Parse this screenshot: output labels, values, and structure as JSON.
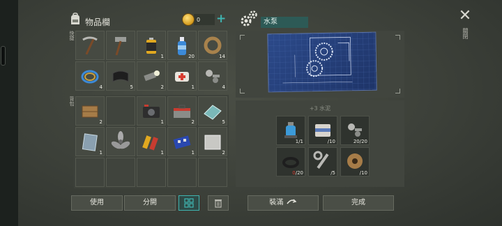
{
  "inventory": {
    "title": "物品欄",
    "coins": "0",
    "plus": "+",
    "hotbar_label": "快捷",
    "backpack_label": "背包",
    "hotbar": [
      {
        "name": "pickaxe",
        "icon": "pickaxe-icon",
        "qty": ""
      },
      {
        "name": "hammer",
        "icon": "hammer-icon",
        "qty": ""
      },
      {
        "name": "battery",
        "icon": "battery-icon",
        "qty": "1"
      },
      {
        "name": "water-bottle",
        "icon": "water-bottle-icon",
        "qty": "20"
      },
      {
        "name": "rope",
        "icon": "rope-icon",
        "qty": "14"
      },
      {
        "name": "wire",
        "icon": "wire-icon",
        "qty": "4"
      },
      {
        "name": "cloth",
        "icon": "cloth-icon",
        "qty": "5"
      },
      {
        "name": "flashlight",
        "icon": "flashlight-icon",
        "qty": "2"
      },
      {
        "name": "bandage",
        "icon": "bandage-icon",
        "qty": "1"
      },
      {
        "name": "nuts-bolts",
        "icon": "bolts-icon",
        "qty": "4"
      }
    ],
    "backpack": [
      {
        "name": "crate",
        "icon": "crate-icon",
        "qty": "2"
      },
      {
        "name": "empty",
        "icon": "",
        "qty": ""
      },
      {
        "name": "camera",
        "icon": "camera-icon",
        "qty": "1"
      },
      {
        "name": "toolbox",
        "icon": "toolbox-icon",
        "qty": "2"
      },
      {
        "name": "glass",
        "icon": "glass-icon",
        "qty": "5"
      },
      {
        "name": "mirror",
        "icon": "mirror-icon",
        "qty": "1"
      },
      {
        "name": "propeller",
        "icon": "propeller-icon",
        "qty": ""
      },
      {
        "name": "batteries",
        "icon": "batteries-icon",
        "qty": "1"
      },
      {
        "name": "circuit-board",
        "icon": "circuit-icon",
        "qty": "1"
      },
      {
        "name": "metal-plate",
        "icon": "metal-plate-icon",
        "qty": "2"
      },
      {
        "name": "empty",
        "icon": "",
        "qty": ""
      },
      {
        "name": "empty",
        "icon": "",
        "qty": ""
      },
      {
        "name": "empty",
        "icon": "",
        "qty": ""
      },
      {
        "name": "empty",
        "icon": "",
        "qty": ""
      },
      {
        "name": "empty",
        "icon": "",
        "qty": ""
      }
    ],
    "buttons": {
      "use": "使用",
      "split": "分開"
    }
  },
  "crafting": {
    "recipe_name": "水泵",
    "req_title": "+3 水泥",
    "requirements": [
      {
        "name": "water-pump",
        "icon": "pump-icon",
        "have": "1",
        "need": "/1",
        "lacking": false
      },
      {
        "name": "cement-bag",
        "icon": "cement-icon",
        "have": "",
        "need": "/10",
        "lacking": true
      },
      {
        "name": "nuts-bolts",
        "icon": "bolts-icon",
        "have": "20",
        "need": "/20",
        "lacking": false
      },
      {
        "name": "rubber-ring",
        "icon": "ring-icon",
        "have": "0",
        "need": "/20",
        "lacking": true
      },
      {
        "name": "wrench",
        "icon": "wrench-icon",
        "have": "",
        "need": "/5",
        "lacking": true
      },
      {
        "name": "wire-spool",
        "icon": "spool-icon",
        "have": "",
        "need": "/10",
        "lacking": true
      }
    ],
    "buttons": {
      "fill": "裝滿",
      "complete": "完成"
    }
  },
  "side_label": "關閉",
  "colors": {
    "accent": "#3fb4b0",
    "lacking": "#d83c30",
    "blueprint": "#2c4a8a"
  }
}
